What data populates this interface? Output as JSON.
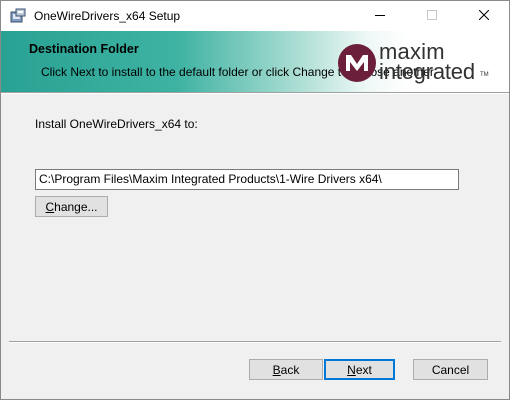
{
  "window": {
    "title": "OneWireDrivers_x64 Setup",
    "minimize_icon": "minimize-icon",
    "maximize_icon": "maximize-icon",
    "close_icon": "close-icon"
  },
  "banner": {
    "heading": "Destination Folder",
    "description": "Click Next to install to the default folder or click Change to choose another.",
    "logo": {
      "line1": "maxim",
      "line2": "integrated",
      "tm": "TM",
      "brand_color": "#6c1f3a"
    }
  },
  "main": {
    "install_label": "Install OneWireDrivers_x64 to:",
    "install_path": "C:\\Program Files\\Maxim Integrated Products\\1-Wire Drivers x64\\",
    "change_button": {
      "mnemonic": "C",
      "rest": "hange..."
    }
  },
  "footer": {
    "back_button": {
      "mnemonic": "B",
      "rest": "ack"
    },
    "next_button": {
      "mnemonic": "N",
      "rest": "ext"
    },
    "cancel_button": "Cancel"
  },
  "colors": {
    "banner_teal": "#28a293",
    "focus_border": "#0078d7"
  }
}
